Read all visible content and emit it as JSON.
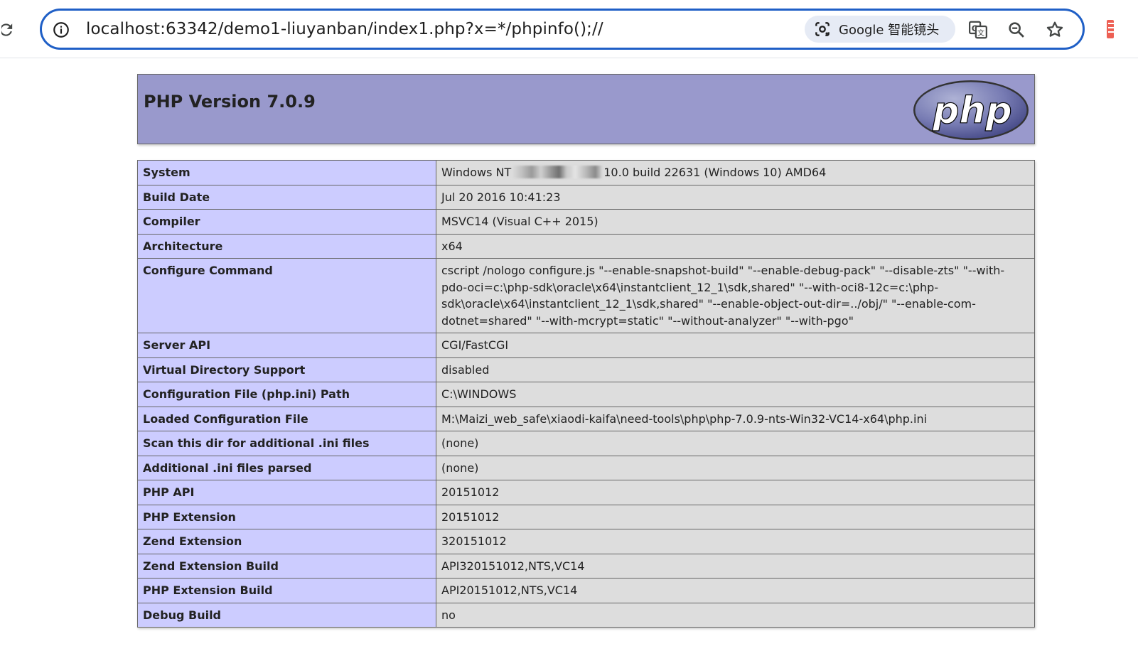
{
  "browser": {
    "url": "localhost:63342/demo1-liuyanban/index1.php?x=*/phpinfo();//",
    "lens_label": "Google 智能镜头",
    "icons": [
      "reload-icon",
      "site-info-icon",
      "google-lens-icon",
      "translate-icon",
      "zoom-icon",
      "bookmark-star-icon"
    ]
  },
  "page": {
    "title": "PHP Version 7.0.9",
    "logo_text": "php",
    "rows": [
      {
        "label": "System",
        "value_prefix": "Windows NT",
        "value_suffix": "10.0 build 22631 (Windows 10) AMD64",
        "redacted": true
      },
      {
        "label": "Build Date",
        "value": "Jul 20 2016 10:41:23"
      },
      {
        "label": "Compiler",
        "value": "MSVC14 (Visual C++ 2015)"
      },
      {
        "label": "Architecture",
        "value": "x64"
      },
      {
        "label": "Configure Command",
        "value": "cscript /nologo configure.js \"--enable-snapshot-build\" \"--enable-debug-pack\" \"--disable-zts\" \"--with-pdo-oci=c:\\php-sdk\\oracle\\x64\\instantclient_12_1\\sdk,shared\" \"--with-oci8-12c=c:\\php-sdk\\oracle\\x64\\instantclient_12_1\\sdk,shared\" \"--enable-object-out-dir=../obj/\" \"--enable-com-dotnet=shared\" \"--with-mcrypt=static\" \"--without-analyzer\" \"--with-pgo\""
      },
      {
        "label": "Server API",
        "value": "CGI/FastCGI"
      },
      {
        "label": "Virtual Directory Support",
        "value": "disabled"
      },
      {
        "label": "Configuration File (php.ini) Path",
        "value": "C:\\WINDOWS"
      },
      {
        "label": "Loaded Configuration File",
        "value": "M:\\Maizi_web_safe\\xiaodi-kaifa\\need-tools\\php\\php-7.0.9-nts-Win32-VC14-x64\\php.ini"
      },
      {
        "label": "Scan this dir for additional .ini files",
        "value": "(none)"
      },
      {
        "label": "Additional .ini files parsed",
        "value": "(none)"
      },
      {
        "label": "PHP API",
        "value": "20151012"
      },
      {
        "label": "PHP Extension",
        "value": "20151012"
      },
      {
        "label": "Zend Extension",
        "value": "320151012"
      },
      {
        "label": "Zend Extension Build",
        "value": "API320151012,NTS,VC14"
      },
      {
        "label": "PHP Extension Build",
        "value": "API20151012,NTS,VC14"
      },
      {
        "label": "Debug Build",
        "value": "no"
      }
    ]
  },
  "colors": {
    "header_bg": "#9999cc",
    "label_bg": "#ccccff",
    "value_bg": "#dddddd",
    "omnibox_border": "#1f5fc6"
  }
}
